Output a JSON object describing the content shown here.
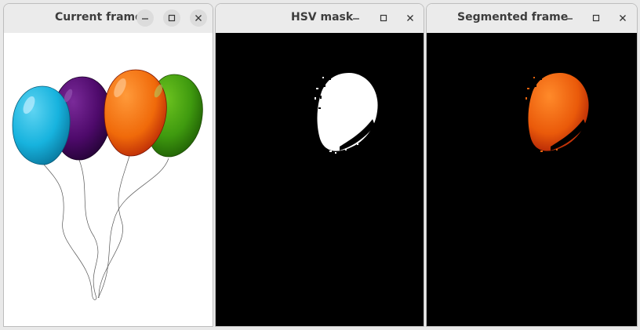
{
  "windows": [
    {
      "title": "Current frame",
      "content": "balloons"
    },
    {
      "title": "HSV mask",
      "content": "mask"
    },
    {
      "title": "Segmented frame",
      "content": "segmented"
    }
  ],
  "controls": {
    "minimize": "minimize-icon",
    "maximize": "maximize-icon",
    "close": "close-icon"
  },
  "colors": {
    "cyan_balloon": "#17b3de",
    "purple_balloon": "#4e0a6b",
    "orange_balloon": "#f06a0a",
    "green_balloon": "#3f9a0f",
    "mask_foreground": "#ffffff",
    "background_dark": "#000000"
  }
}
